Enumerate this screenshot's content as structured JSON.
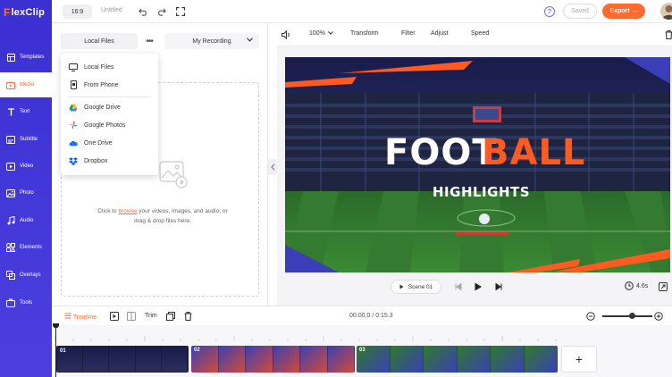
{
  "app": {
    "logo_text": "lexClip",
    "logo_initial": "F"
  },
  "topbar": {
    "aspect_ratio": "16:9",
    "project_title": "Untitled",
    "help_label": "?",
    "saved_label": "Saved",
    "export_label": "Export →"
  },
  "sidebar": {
    "items": [
      {
        "label": "Templates",
        "icon": "templates-icon"
      },
      {
        "label": "Media",
        "icon": "media-icon",
        "active": true
      },
      {
        "label": "Text",
        "icon": "text-icon"
      },
      {
        "label": "Subtitle",
        "icon": "subtitle-icon"
      },
      {
        "label": "Video",
        "icon": "video-icon"
      },
      {
        "label": "Photo",
        "icon": "photo-icon"
      },
      {
        "label": "Audio",
        "icon": "audio-icon"
      },
      {
        "label": "Elements",
        "icon": "elements-icon"
      },
      {
        "label": "Overlays",
        "icon": "overlays-icon"
      },
      {
        "label": "Tools",
        "icon": "tools-icon"
      }
    ]
  },
  "media_panel": {
    "local_files_tab": "Local Files",
    "more_label": "•••",
    "recording_tab": "My Recording",
    "dropzone_text_before": "Click to ",
    "dropzone_link": "browse",
    "dropzone_text_after": " your videos, images, and audio, or drag & drop files here."
  },
  "upload_menu": {
    "items": [
      {
        "label": "Local Files",
        "icon": "monitor-icon"
      },
      {
        "label": "From Phone",
        "icon": "phone-icon"
      },
      {
        "label": "Google Drive",
        "icon": "google-drive-icon"
      },
      {
        "label": "Google Photos",
        "icon": "google-photos-icon"
      },
      {
        "label": "One Drive",
        "icon": "onedrive-icon"
      },
      {
        "label": "Dropbox",
        "icon": "dropbox-icon"
      }
    ]
  },
  "edit_toolbar": {
    "zoom": "100%",
    "transform": "Transform",
    "filter": "Filter",
    "adjust": "Adjust",
    "speed": "Speed"
  },
  "preview": {
    "title_white": "FOOT",
    "title_orange": "BALL",
    "subtitle": "HIGHLIGHTS",
    "colors": {
      "accent": "#ff5a1f",
      "brand": "#4b3fe0",
      "field": "#2f7a2a"
    }
  },
  "playback": {
    "scene_label": "Scene",
    "scene_number": "01",
    "duration": "4.6s"
  },
  "timeline": {
    "timeline_label": "Timeline",
    "trim_label": "Trim",
    "time_display": "00:00.0 / 0:15.3",
    "zoom_level": 0.6,
    "clips": [
      {
        "number": "01"
      },
      {
        "number": "02"
      },
      {
        "number": "03"
      }
    ],
    "add_label": "+"
  }
}
